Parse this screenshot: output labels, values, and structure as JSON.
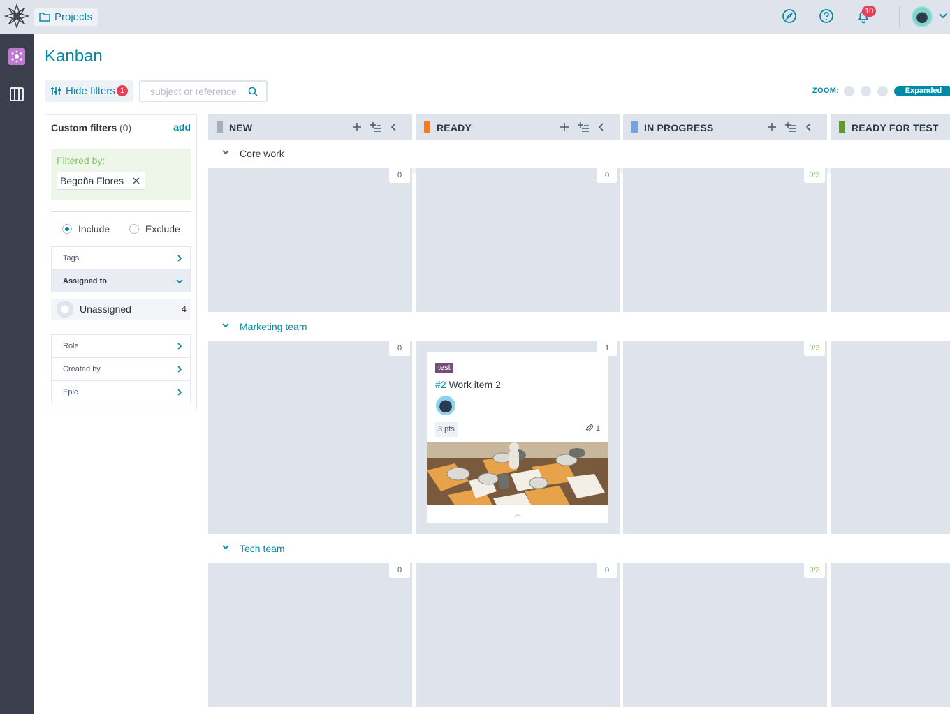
{
  "topbar": {
    "projects_label": "Projects",
    "notifications_count": "10",
    "icons": [
      "logo-icon",
      "folder-icon",
      "discover-icon",
      "help-icon",
      "bell-icon",
      "user-avatar",
      "chevron-down-icon"
    ]
  },
  "sidenav": {
    "items": [
      "project-thumb",
      "kanban-icon"
    ]
  },
  "header": {
    "title": "Kanban",
    "hide_filters_label": "Hide filters",
    "hide_filters_badge": "1",
    "search_placeholder": "subject or reference",
    "zoom_label": "ZOOM:",
    "zoom_active": "Expanded"
  },
  "filters": {
    "custom_filters_label": "Custom filters",
    "custom_filters_count": "(0)",
    "add_label": "add",
    "filtered_by_label": "Filtered by:",
    "active_chip": "Begoña Flores",
    "include_label": "Include",
    "exclude_label": "Exclude",
    "mode_selected": "Include",
    "categories": [
      {
        "label": "Tags",
        "open": false
      },
      {
        "label": "Assigned to",
        "open": true
      }
    ],
    "assigned_options": [
      {
        "name": "Unassigned",
        "count": "4"
      }
    ],
    "more_categories": [
      {
        "label": "Role"
      },
      {
        "label": "Created by"
      },
      {
        "label": "Epic"
      }
    ]
  },
  "columns": [
    {
      "title": "NEW",
      "color": "#a9aebc"
    },
    {
      "title": "READY",
      "color": "#f87b17"
    },
    {
      "title": "IN PROGRESS",
      "color": "#75a3de"
    },
    {
      "title": "READY FOR TEST",
      "color": "#5e9c26"
    }
  ],
  "swimlanes": [
    {
      "title": "Core work",
      "counts": [
        "0",
        "0",
        "0/3"
      ]
    },
    {
      "title": "Marketing team",
      "counts": [
        "0",
        "1",
        "0/3"
      ]
    },
    {
      "title": "Tech team",
      "counts": [
        "0",
        "0",
        "0/3"
      ]
    }
  ],
  "card": {
    "tag": "test",
    "tag_color": "#7a4b7e",
    "ref": "#2",
    "title": "Work item 2",
    "points": "3 pts",
    "attachments": "1"
  },
  "colors": {
    "accent": "#008aa8",
    "badge": "#e44057",
    "topbar_bg": "#dfe3ec",
    "sidenav_bg": "#3b3f4d"
  }
}
